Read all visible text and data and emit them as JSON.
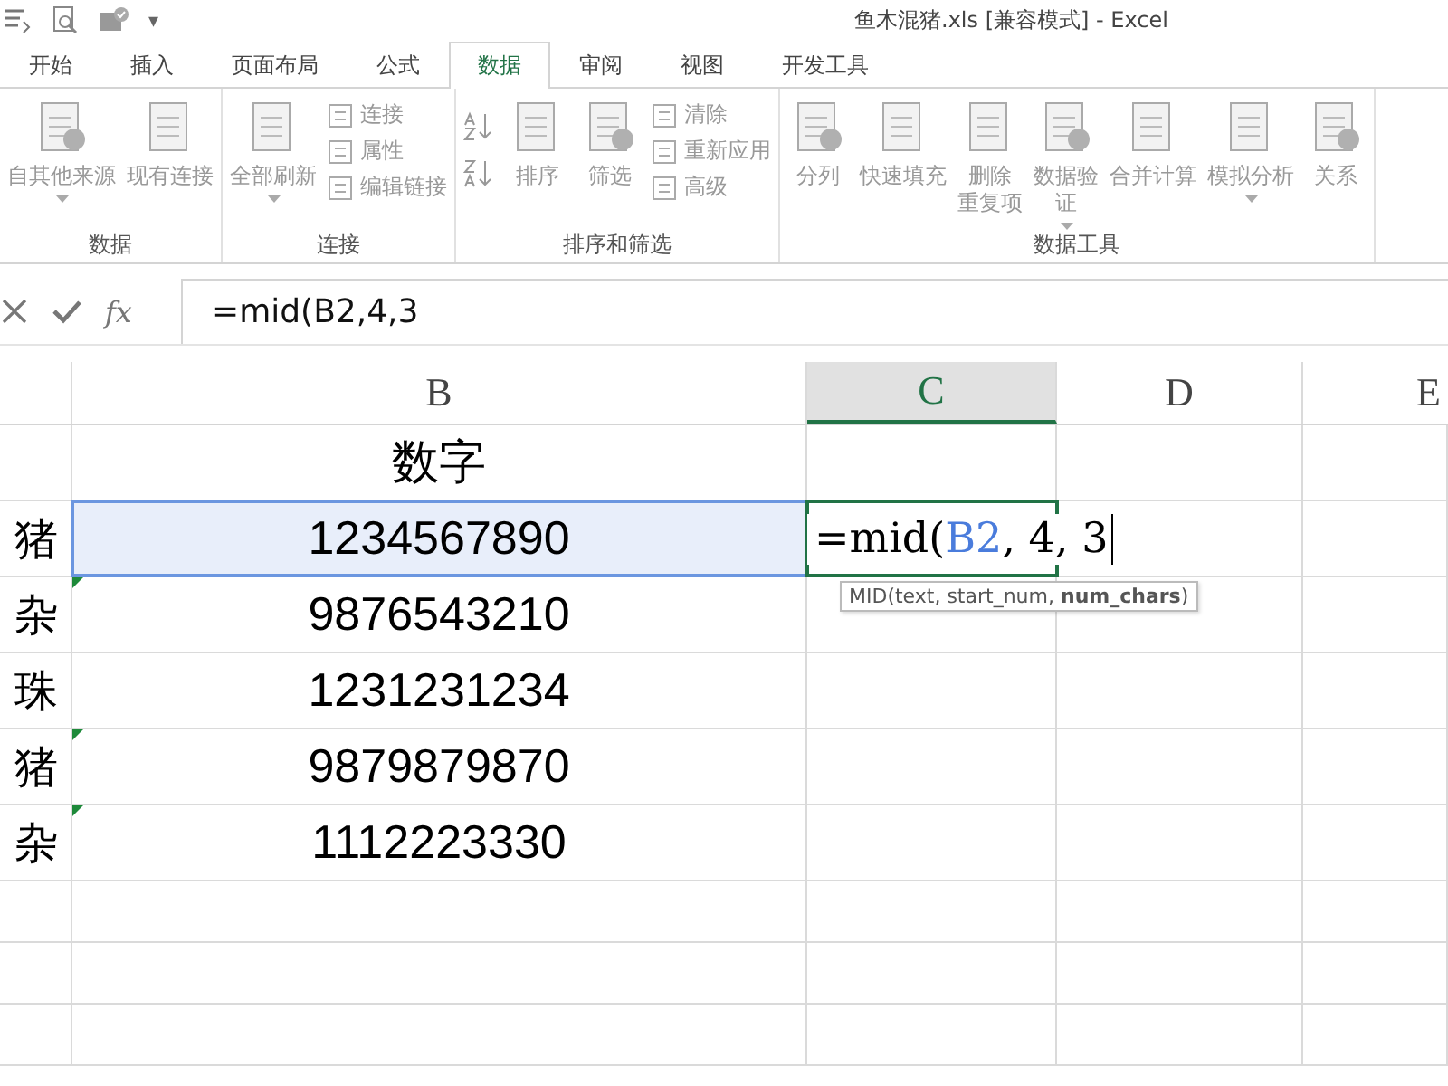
{
  "window": {
    "title": "鱼木混猪.xls  [兼容模式] - Excel",
    "quick_access_more": "▾"
  },
  "tabs": [
    {
      "label": "开始",
      "selected": false
    },
    {
      "label": "插入",
      "selected": false
    },
    {
      "label": "页面布局",
      "selected": false
    },
    {
      "label": "公式",
      "selected": false
    },
    {
      "label": "数据",
      "selected": true
    },
    {
      "label": "审阅",
      "selected": false
    },
    {
      "label": "视图",
      "selected": false
    },
    {
      "label": "开发工具",
      "selected": false
    }
  ],
  "ribbon": {
    "groups": [
      {
        "label": "数据",
        "large": [
          {
            "lines": [
              "自其他来源"
            ],
            "dropdown": true,
            "disabled": true
          },
          {
            "lines": [
              "现有连接"
            ],
            "dropdown": false,
            "disabled": true
          }
        ]
      },
      {
        "label": "连接",
        "large": [
          {
            "lines": [
              "全部刷新"
            ],
            "dropdown": true,
            "disabled": true
          }
        ],
        "small": [
          {
            "label": "连接",
            "disabled": true
          },
          {
            "label": "属性",
            "disabled": true
          },
          {
            "label": "编辑链接",
            "disabled": true
          }
        ]
      },
      {
        "label": "排序和筛选",
        "sort": true,
        "large": [
          {
            "lines": [
              "排序"
            ],
            "dropdown": false,
            "disabled": true
          },
          {
            "lines": [
              "筛选"
            ],
            "dropdown": false,
            "disabled": true
          }
        ],
        "small": [
          {
            "label": "清除",
            "disabled": true
          },
          {
            "label": "重新应用",
            "disabled": true
          },
          {
            "label": "高级",
            "disabled": true
          }
        ]
      },
      {
        "label": "数据工具",
        "large": [
          {
            "lines": [
              "分列"
            ],
            "dropdown": false,
            "disabled": true
          },
          {
            "lines": [
              "快速填充"
            ],
            "dropdown": false,
            "disabled": true
          },
          {
            "lines": [
              "删除",
              "重复项"
            ],
            "dropdown": false,
            "disabled": true
          },
          {
            "lines": [
              "数据验",
              "证"
            ],
            "dropdown": true,
            "disabled": true
          },
          {
            "lines": [
              "合并计算"
            ],
            "dropdown": false,
            "disabled": true
          },
          {
            "lines": [
              "模拟分析"
            ],
            "dropdown": true,
            "disabled": true
          },
          {
            "lines": [
              "关系"
            ],
            "dropdown": false,
            "disabled": true
          }
        ]
      }
    ]
  },
  "formula_bar": {
    "function_label": "fx",
    "value": "=mid(B2,4,3"
  },
  "columns": [
    {
      "label": "B",
      "selected": false
    },
    {
      "label": "C",
      "selected": true
    },
    {
      "label": "D",
      "selected": false
    },
    {
      "label": "E",
      "selected": false
    }
  ],
  "rows": [
    {
      "cell_a": "",
      "cell_b": "数字",
      "selected": false,
      "error_flag": false
    },
    {
      "cell_a": "猪",
      "cell_b": "1234567890",
      "selected": true,
      "error_flag": false,
      "edit": {
        "segments": [
          {
            "text": "=mid(",
            "kind": "plain"
          },
          {
            "text": "B2",
            "kind": "ref"
          },
          {
            "text": ", 4, 3",
            "kind": "plain"
          }
        ],
        "tooltip": "MID(text, start_num, **num_chars**)"
      }
    },
    {
      "cell_a": "杂",
      "cell_b": "9876543210",
      "selected": false,
      "error_flag": true
    },
    {
      "cell_a": "珠",
      "cell_b": "1231231234",
      "selected": false,
      "error_flag": false
    },
    {
      "cell_a": "猪",
      "cell_b": "9879879870",
      "selected": false,
      "error_flag": true
    },
    {
      "cell_a": "杂",
      "cell_b": "1112223330",
      "selected": false,
      "error_flag": true
    }
  ]
}
